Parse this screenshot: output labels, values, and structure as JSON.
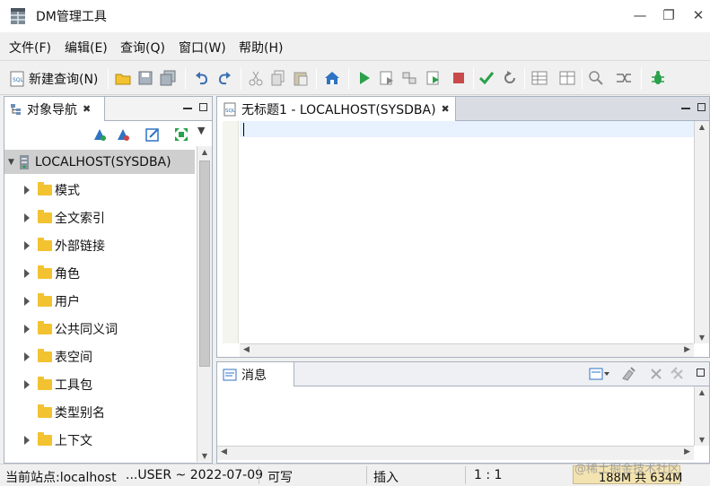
{
  "window": {
    "title": "DM管理工具",
    "minimize": "—",
    "maximize": "❐",
    "close": "✕"
  },
  "menu": {
    "items": [
      "文件(F)",
      "编辑(E)",
      "查询(Q)",
      "窗口(W)",
      "帮助(H)"
    ]
  },
  "toolbar": {
    "new_query_label": "新建查询(N)"
  },
  "navigator": {
    "tab_label": "对象导航",
    "root": "LOCALHOST(SYSDBA)",
    "items": [
      {
        "label": "模式",
        "expandable": true
      },
      {
        "label": "全文索引",
        "expandable": true
      },
      {
        "label": "外部链接",
        "expandable": true
      },
      {
        "label": "角色",
        "expandable": true
      },
      {
        "label": "用户",
        "expandable": true
      },
      {
        "label": "公共同义词",
        "expandable": true
      },
      {
        "label": "表空间",
        "expandable": true
      },
      {
        "label": "工具包",
        "expandable": true
      },
      {
        "label": "类型别名",
        "expandable": false
      },
      {
        "label": "上下文",
        "expandable": true
      }
    ]
  },
  "editor": {
    "tab_label": "无标题1 - LOCALHOST(SYSDBA)",
    "content": ""
  },
  "messages": {
    "tab_label": "消息"
  },
  "status": {
    "site": "当前站点:localhost",
    "user": "...USER ~ 2022-07-09",
    "mode": "可写",
    "insert": "插入",
    "position": "1 : 1",
    "memory": "188M 共 634M"
  },
  "watermark": "@稀土掘金技术社区",
  "colors": {
    "selection": "#cfcfcf",
    "folder": "#f2c230",
    "current_line": "#e8f2fe",
    "memory_bg": "#f3e3b0"
  }
}
